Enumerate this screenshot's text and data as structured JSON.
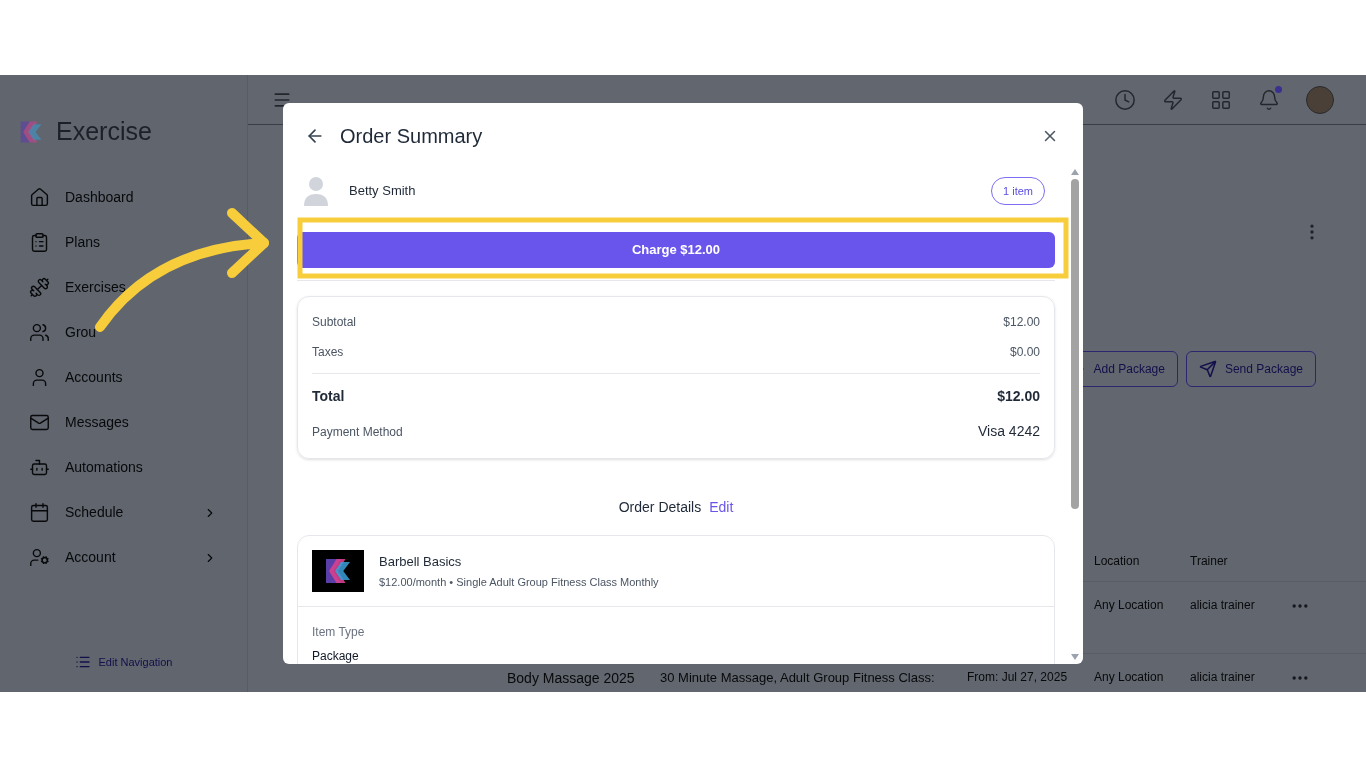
{
  "app": {
    "brand": "Exercise",
    "nav": [
      {
        "label": "Dashboard",
        "submenu": false
      },
      {
        "label": "Plans",
        "submenu": false
      },
      {
        "label": "Exercises",
        "submenu": false
      },
      {
        "label": "Grou",
        "submenu": false
      },
      {
        "label": "Accounts",
        "submenu": false
      },
      {
        "label": "Messages",
        "submenu": false
      },
      {
        "label": "Automations",
        "submenu": false
      },
      {
        "label": "Schedule",
        "submenu": true
      },
      {
        "label": "Account",
        "submenu": true
      }
    ],
    "edit_navigation": "Edit Navigation",
    "notifications_unread": true,
    "buttons": [
      {
        "label": "Add Package",
        "kind": "add"
      },
      {
        "label": "Send Package",
        "kind": "send"
      }
    ],
    "table": {
      "columns": [
        "Location",
        "Trainer"
      ],
      "rows": [
        {
          "name": "",
          "description": "",
          "date": "",
          "location": "Any Location",
          "trainer": "alicia trainer"
        },
        {
          "name": "Body Massage 2025",
          "description": "30 Minute Massage, Adult Group Fitness Class:",
          "date": "From: Jul 27, 2025",
          "location": "Any Location",
          "trainer": "alicia trainer"
        }
      ]
    }
  },
  "modal": {
    "title": "Order Summary",
    "customer": "Betty Smith",
    "item_count": "1 item",
    "charge_button": "Charge $12.00",
    "summary": [
      {
        "label": "Subtotal",
        "value": "$12.00",
        "kind": "line"
      },
      {
        "label": "Taxes",
        "value": "$0.00",
        "kind": "line"
      },
      {
        "label": "Total",
        "value": "$12.00",
        "kind": "total"
      },
      {
        "label": "Payment Method",
        "value": "Visa 4242",
        "kind": "payment"
      }
    ],
    "order_details": {
      "heading": "Order Details",
      "edit": "Edit"
    },
    "item": {
      "name": "Barbell Basics",
      "description": "$12.00/month • Single Adult Group Fitness Class Monthly",
      "fields": [
        {
          "label": "Item Type",
          "value": "Package"
        }
      ]
    }
  }
}
